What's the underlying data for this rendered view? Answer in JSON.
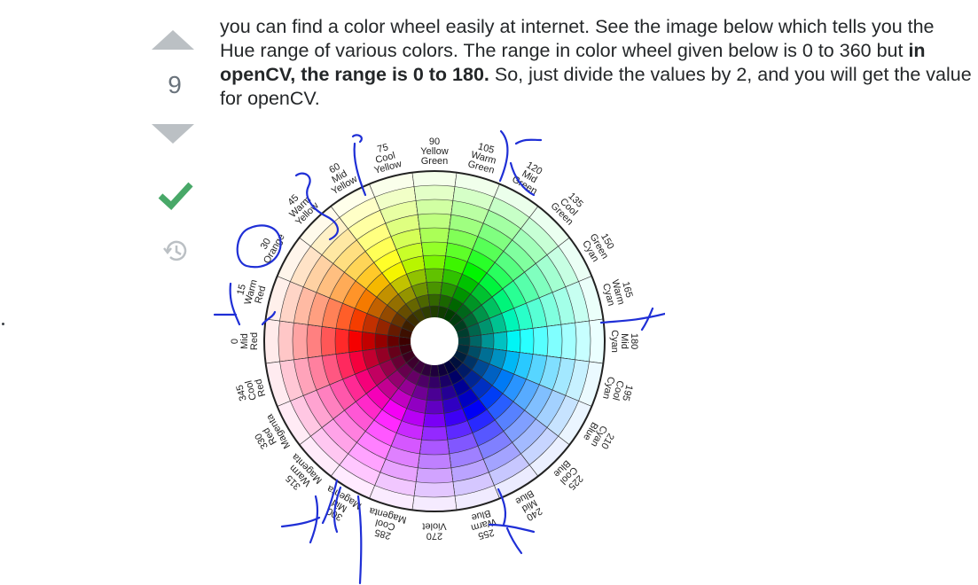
{
  "vote": {
    "count": "9",
    "up_icon": "arrow-up-icon",
    "down_icon": "arrow-down-icon",
    "accepted_icon": "checkmark-icon",
    "history_icon": "history-icon",
    "accepted_color": "#48a868",
    "arrow_color": "#bbc0c4"
  },
  "answer": {
    "text_part1": "you can find a color wheel easily at internet. See the image below which tells you the Hue range of various colors. The range in color wheel given below is 0 to 360 but ",
    "text_bold": "in openCV, the range is 0 to 180.",
    "text_part2": " So, just divide the values by 2, and you will get the value for openCV."
  },
  "wheel": {
    "labels": [
      {
        "deg": "0",
        "name": "Mid Red"
      },
      {
        "deg": "15",
        "name": "Warm Red"
      },
      {
        "deg": "30",
        "name": "Orange"
      },
      {
        "deg": "45",
        "name": "Warm Yellow"
      },
      {
        "deg": "60",
        "name": "Mid Yellow"
      },
      {
        "deg": "75",
        "name": "Cool Yellow"
      },
      {
        "deg": "90",
        "name": "Yellow Green"
      },
      {
        "deg": "105",
        "name": "Warm Green"
      },
      {
        "deg": "120",
        "name": "Mid Green"
      },
      {
        "deg": "135",
        "name": "Cool Green"
      },
      {
        "deg": "150",
        "name": "Green Cyan"
      },
      {
        "deg": "165",
        "name": "Warm Cyan"
      },
      {
        "deg": "180",
        "name": "Mid Cyan"
      },
      {
        "deg": "195",
        "name": "Cool Cyan"
      },
      {
        "deg": "210",
        "name": "Cyan Blue"
      },
      {
        "deg": "225",
        "name": "Cool Blue"
      },
      {
        "deg": "240",
        "name": "Mid Blue"
      },
      {
        "deg": "255",
        "name": "Warm Blue"
      },
      {
        "deg": "270",
        "name": "Violet"
      },
      {
        "deg": "285",
        "name": "Cool Magenta"
      },
      {
        "deg": "300",
        "name": "Mid Magenta"
      },
      {
        "deg": "315",
        "name": "Warm Magenta"
      },
      {
        "deg": "330",
        "name": "Red Magenta"
      },
      {
        "deg": "345",
        "name": "Cool Red"
      }
    ],
    "annotation_color": "#1f2fd6"
  }
}
